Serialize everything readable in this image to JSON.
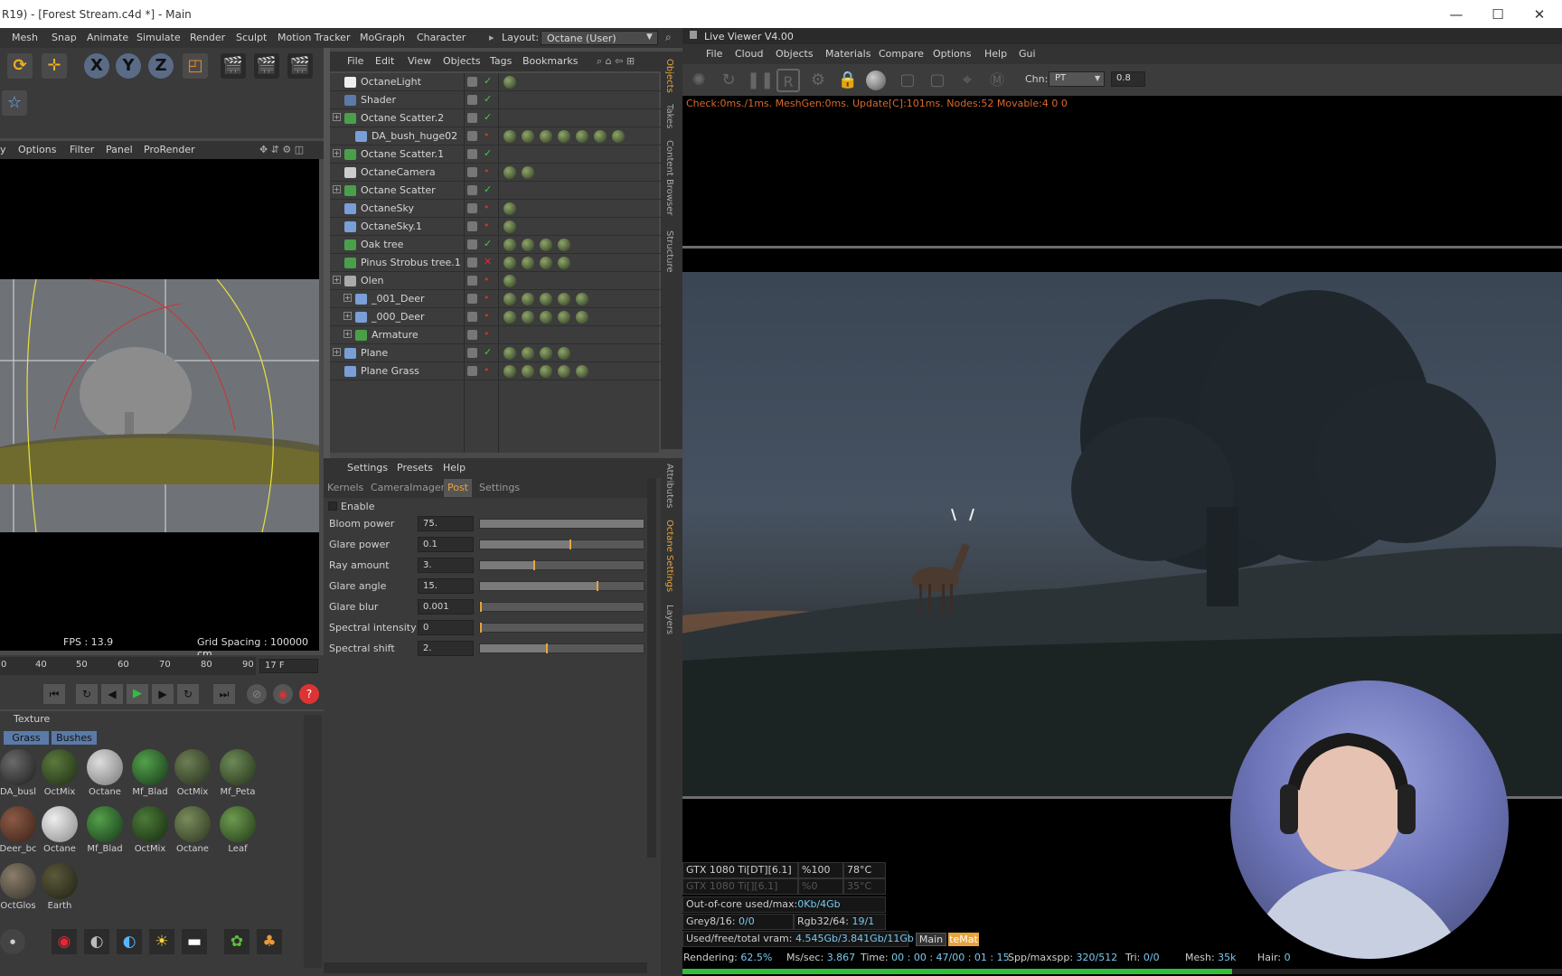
{
  "window": {
    "title": "R19) - [Forest Stream.c4d *] - Main",
    "controls": [
      "—",
      "☐",
      "✕"
    ]
  },
  "c4d_menu": {
    "items": [
      "Mesh",
      "Snap",
      "Animate",
      "Simulate",
      "Render",
      "Sculpt",
      "Motion Tracker",
      "MoGraph",
      "Character"
    ],
    "layout_label": "Layout:",
    "layout_value": "Octane (User)"
  },
  "toolbar": {
    "axis_x": "X",
    "axis_y": "Y",
    "axis_z": "Z"
  },
  "viewport": {
    "menu": [
      "y",
      "Options",
      "Filter",
      "Panel",
      "ProRender"
    ],
    "fps": "FPS : 13.9",
    "grid_spacing": "Grid Spacing : 100000 cm"
  },
  "timeline": {
    "ticks": [
      "0",
      "40",
      "50",
      "60",
      "70",
      "80",
      "90"
    ],
    "frame": "17 F"
  },
  "materials": {
    "header": "Texture",
    "tabs": [
      "Grass",
      "Bushes"
    ],
    "row1": [
      "DA_busl",
      "OctMix",
      "Octane",
      "Mf_Blad",
      "OctMix",
      "Mf_Peta"
    ],
    "row2": [
      "Deer_bc",
      "Octane",
      "Mf_Blad",
      "OctMix",
      "Octane",
      "Leaf"
    ],
    "row3": [
      "OctGlos",
      "Earth"
    ]
  },
  "object_manager": {
    "menu": [
      "File",
      "Edit",
      "View",
      "Objects",
      "Tags",
      "Bookmarks"
    ],
    "side_tabs": [
      "Objects",
      "Takes",
      "Content Browser",
      "Structure"
    ],
    "objects": [
      {
        "name": "OctaneLight"
      },
      {
        "name": "Shader"
      },
      {
        "name": "Octane Scatter.2"
      },
      {
        "name": "DA_bush_huge02"
      },
      {
        "name": "Octane Scatter.1"
      },
      {
        "name": "OctaneCamera"
      },
      {
        "name": "Octane Scatter"
      },
      {
        "name": "OctaneSky"
      },
      {
        "name": "OctaneSky.1"
      },
      {
        "name": "Oak tree"
      },
      {
        "name": "Pinus Strobus tree.1"
      },
      {
        "name": "Olen"
      },
      {
        "name": "_001_Deer"
      },
      {
        "name": "_000_Deer"
      },
      {
        "name": "Armature"
      },
      {
        "name": "Plane"
      },
      {
        "name": "Plane Grass"
      }
    ]
  },
  "attributes": {
    "menu": [
      "Settings",
      "Presets",
      "Help"
    ],
    "tabs": [
      "Kernels",
      "CameraImager",
      "Post",
      "Settings"
    ],
    "active_tab": "Post",
    "side_tabs": [
      "Attributes",
      "Octane Settings",
      "Layers"
    ],
    "enable_label": "Enable",
    "settings": [
      {
        "label": "Bloom power",
        "value": "75.",
        "level": 1.0
      },
      {
        "label": "Glare power",
        "value": "0.1",
        "level": 0.55
      },
      {
        "label": "Ray amount",
        "value": "3.",
        "level": 0.33
      },
      {
        "label": "Glare angle",
        "value": "15.",
        "level": 0.72
      },
      {
        "label": "Glare blur",
        "value": "0.001",
        "level": 0.0
      },
      {
        "label": "Spectral intensity",
        "value": "0",
        "level": 0.0
      },
      {
        "label": "Spectral shift",
        "value": "2.",
        "level": 0.41
      }
    ]
  },
  "live_viewer": {
    "title": "Live Viewer V4.00",
    "menu": [
      "File",
      "Cloud",
      "Objects",
      "Materials",
      "Compare",
      "Options",
      "Help",
      "Gui"
    ],
    "chn_label": "Chn:",
    "chn_value": "PT",
    "chn_num": "0.8",
    "status_line": "Check:0ms./1ms. MeshGen:0ms. Update[C]:101ms. Nodes:52 Movable:4  0 0",
    "gpu1": {
      "name": "GTX 1080 Ti[DT][6.1]",
      "pct": "%100",
      "temp": "78°C"
    },
    "gpu2": {
      "name": "GTX 1080 Ti[][6.1]",
      "pct": "%0",
      "temp": "35°C"
    },
    "out_of_core_label": "Out-of-core used/max:",
    "out_of_core_value": "0Kb/4Gb",
    "grey_label": "Grey8/16: ",
    "grey_value": "0/0",
    "rgb_label": "Rgb32/64: ",
    "rgb_value": "19/1",
    "vram_label": "Used/free/total vram: ",
    "vram_value": "4.545Gb/3.841Gb/11Gb",
    "tab_main": "Main",
    "tab_mat": "teMat",
    "rendering_label": "Rendering: ",
    "rendering_value": "62.5%",
    "progress": 0.625,
    "mssec_label": "Ms/sec: ",
    "mssec_value": "3.867",
    "time_label": "Time: ",
    "time_value": "00 : 00 : 47/00 : 01 : 15",
    "spp_label": "Spp/maxspp: ",
    "spp_value": "320/512",
    "tri_label": "Tri: ",
    "tri_value": "0/0",
    "mesh_label": "Mesh: ",
    "mesh_value": "35k",
    "hair_label": "Hair: ",
    "hair_value": "0"
  },
  "colors": {
    "accent_orange": "#e7a43b",
    "progress_green": "#2fbf3a",
    "stat_blue": "#78c9f0"
  }
}
